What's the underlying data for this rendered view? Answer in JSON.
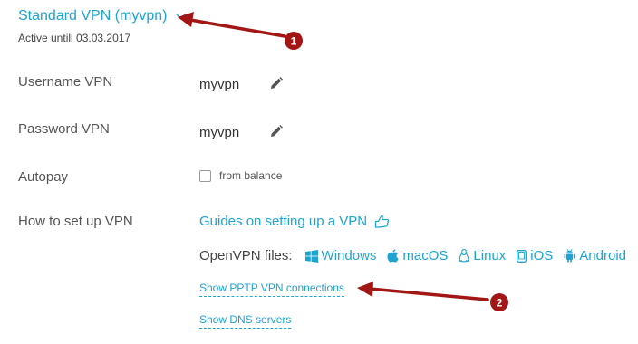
{
  "plan": {
    "title": "Standard VPN (myvpn)",
    "active_until": "Active untill 03.03.2017"
  },
  "rows": {
    "username": {
      "label": "Username VPN",
      "value": "myvpn"
    },
    "password": {
      "label": "Password VPN",
      "value": "myvpn"
    },
    "autopay": {
      "label": "Autopay",
      "option": "from balance",
      "checked": false
    },
    "setup": {
      "label": "How to set up VPN",
      "guides_link": "Guides on setting up a VPN"
    }
  },
  "openvpn": {
    "label": "OpenVPN files:",
    "platforms": [
      {
        "name": "Windows",
        "icon": "windows-icon"
      },
      {
        "name": "macOS",
        "icon": "apple-icon"
      },
      {
        "name": "Linux",
        "icon": "linux-icon"
      },
      {
        "name": "iOS",
        "icon": "ios-device-icon"
      },
      {
        "name": "Android",
        "icon": "android-icon"
      }
    ]
  },
  "links": {
    "pptp": "Show PPTP VPN connections",
    "dns": "Show DNS servers"
  },
  "annotations": [
    {
      "number": "1"
    },
    {
      "number": "2"
    }
  ],
  "colors": {
    "link": "#1ea3d3",
    "annotation": "#a31616",
    "text": "#333333"
  }
}
